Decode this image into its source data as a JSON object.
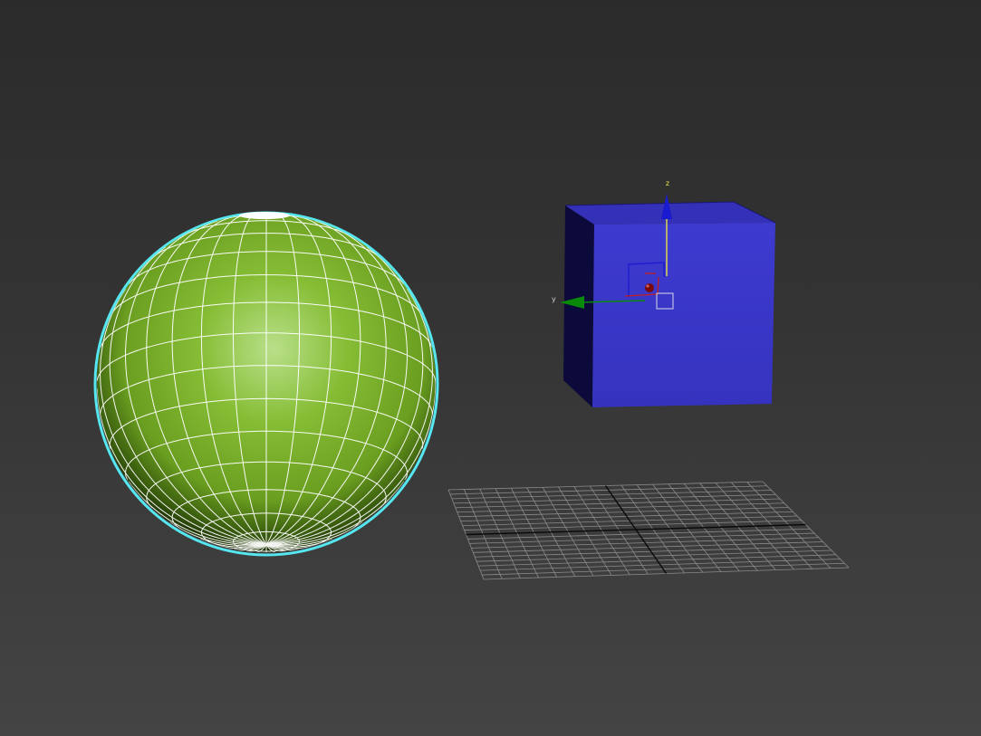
{
  "viewport": {
    "background_top": "#2b2b2b",
    "background_bottom": "#444444"
  },
  "sphere": {
    "color": "#7bb02a",
    "highlight": "#b9e08a",
    "wireframe_color": "#ffffff",
    "selection_color": "#55e6f0"
  },
  "box": {
    "front_color": "#3a36c4",
    "top_color": "#3430b8",
    "side_color": "#0c0a3a"
  },
  "gizmo": {
    "z_label": "z",
    "y_label": "y",
    "z_color": "#1a1ad0",
    "y_color": "#0a8a0a",
    "x_color": "#c02020",
    "z_stem_color": "#e8e04a"
  },
  "grid": {
    "line_color": "#8a8a8a",
    "axis_color": "#0a0a0a"
  }
}
